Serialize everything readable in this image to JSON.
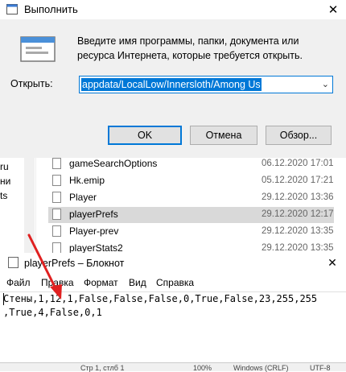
{
  "run_dialog": {
    "title": "Выполнить",
    "close_glyph": "✕",
    "description": "Введите имя программы, папки, документа или ресурса Интернета, которые требуется открыть.",
    "open_label": "Открыть:",
    "open_value": "appdata/LocalLow/Innersloth/Among Us",
    "ok": "OK",
    "cancel": "Отмена",
    "browse": "Обзор..."
  },
  "explorer": {
    "nav_items": [
      "ru",
      "ни",
      "ts"
    ],
    "files": [
      {
        "name": "gameSearchOptions",
        "date": "06.12.2020 17:01"
      },
      {
        "name": "Hk.emip",
        "date": "05.12.2020 17:21"
      },
      {
        "name": "Player",
        "date": "29.12.2020 13:36"
      },
      {
        "name": "playerPrefs",
        "date": "29.12.2020 12:17"
      },
      {
        "name": "Player-prev",
        "date": "29.12.2020 13:35"
      },
      {
        "name": "playerStats2",
        "date": "29.12.2020 13:35"
      }
    ]
  },
  "notepad": {
    "title": "playerPrefs – Блокнот",
    "close_glyph": "✕",
    "menu": [
      "Файл",
      "Правка",
      "Формат",
      "Вид",
      "Справка"
    ],
    "lines": [
      "Стены,1,12,1,False,False,False,0,True,False,23,255,255",
      ",True,4,False,0,1"
    ],
    "status": [
      "Стр 1, стлб 1",
      "100%",
      "Windows (CRLF)",
      "UTF-8"
    ]
  },
  "colors": {
    "accent": "#0078d7",
    "arrow": "#e02020"
  }
}
